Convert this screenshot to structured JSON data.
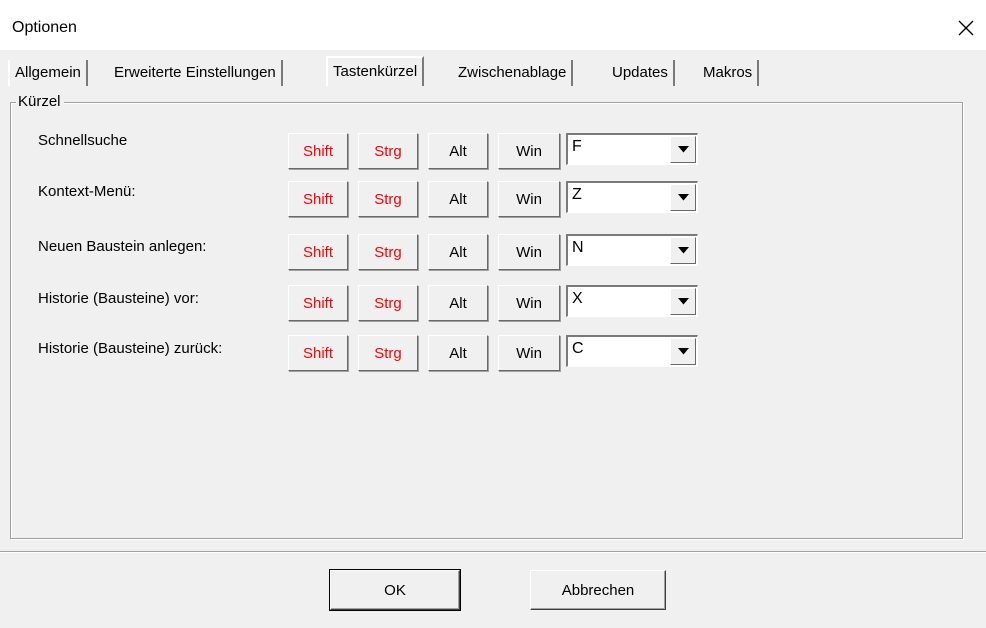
{
  "window": {
    "title": "Optionen",
    "close_symbol": "✕"
  },
  "tabs": [
    {
      "label": "Allgemein"
    },
    {
      "label": "Erweiterte Einstellungen"
    },
    {
      "label": "Tastenkürzel",
      "active": true
    },
    {
      "label": "Zwischenablage"
    },
    {
      "label": "Updates"
    },
    {
      "label": "Makros"
    }
  ],
  "group": {
    "title": "Kürzel"
  },
  "keys": {
    "shift": "Shift",
    "strg": "Strg",
    "alt": "Alt",
    "win": "Win"
  },
  "shortcuts": [
    {
      "label": "Schnellsuche",
      "key": "F",
      "shift_on": true,
      "strg_on": true
    },
    {
      "label": "Kontext-Menü:",
      "key": "Z",
      "shift_on": true,
      "strg_on": true
    },
    {
      "label": "Neuen Baustein anlegen:",
      "key": "N",
      "shift_on": true,
      "strg_on": true
    },
    {
      "label": "Historie (Bausteine) vor:",
      "key": "X",
      "shift_on": true,
      "strg_on": true
    },
    {
      "label": "Historie (Bausteine) zurück:",
      "key": "C",
      "shift_on": true,
      "strg_on": true
    }
  ],
  "buttons": {
    "ok": "OK",
    "cancel": "Abbrechen"
  },
  "colors": {
    "active_modifier": "#ff0000",
    "dialog_bg": "#f0f0f0"
  }
}
